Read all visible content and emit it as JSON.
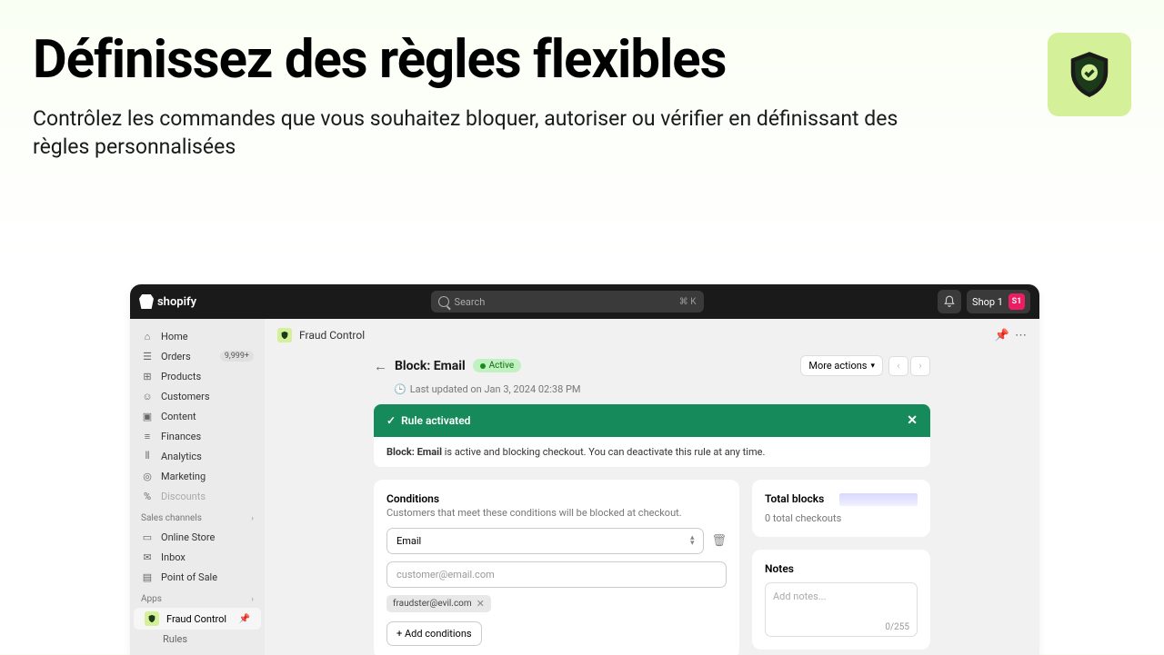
{
  "hero": {
    "title": "Définissez des règles flexibles",
    "subtitle": "Contrôlez les commandes que vous souhaitez bloquer, autoriser ou vérifier en définissant des règles personnalisées"
  },
  "topbar": {
    "brand": "shopify",
    "search_placeholder": "Search",
    "kbd": "⌘ K",
    "shop_label": "Shop 1",
    "avatar_initials": "S1"
  },
  "sidebar": {
    "nav": [
      {
        "label": "Home",
        "icon": "⌂"
      },
      {
        "label": "Orders",
        "icon": "☰",
        "badge": "9,999+"
      },
      {
        "label": "Products",
        "icon": "⊞"
      },
      {
        "label": "Customers",
        "icon": "☺"
      },
      {
        "label": "Content",
        "icon": "▣"
      },
      {
        "label": "Finances",
        "icon": "≡"
      },
      {
        "label": "Analytics",
        "icon": "⫴"
      },
      {
        "label": "Marketing",
        "icon": "◎"
      },
      {
        "label": "Discounts",
        "icon": "%",
        "dim": true
      }
    ],
    "channels_label": "Sales channels",
    "channels": [
      {
        "label": "Online Store",
        "icon": "▭"
      },
      {
        "label": "Inbox",
        "icon": "✉"
      },
      {
        "label": "Point of Sale",
        "icon": "▤"
      }
    ],
    "apps_label": "Apps",
    "app": {
      "label": "Fraud Control",
      "sub": "Rules"
    }
  },
  "appHeader": {
    "title": "Fraud Control"
  },
  "page": {
    "title": "Block: Email",
    "status": "Active",
    "more_actions": "More actions",
    "timestamp": "Last updated on Jan 3, 2024 02:38 PM"
  },
  "banner": {
    "title": "Rule activated",
    "body_strong": "Block: Email",
    "body_rest": " is active and blocking checkout. You can deactivate this rule at any time."
  },
  "conditions": {
    "title": "Conditions",
    "subtitle": "Customers that meet these conditions will be blocked at checkout.",
    "field": "Email",
    "placeholder": "customer@email.com",
    "tag": "fraudster@evil.com",
    "add_btn": "+ Add conditions"
  },
  "totals": {
    "title": "Total blocks",
    "value": "0 total checkouts"
  },
  "notes": {
    "title": "Notes",
    "placeholder": "Add notes...",
    "counter": "0/255"
  }
}
